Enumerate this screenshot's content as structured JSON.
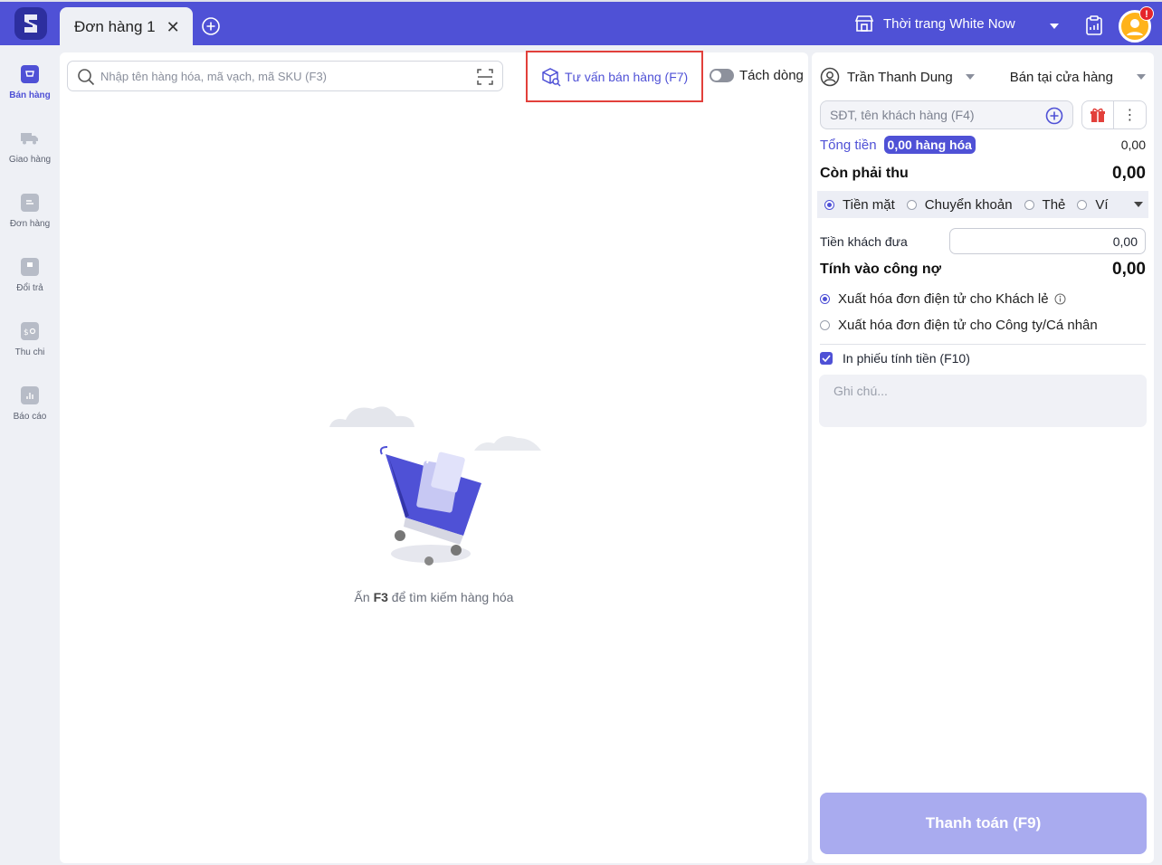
{
  "tabs": [
    {
      "label": "Đơn hàng 1"
    }
  ],
  "header": {
    "store_name": "Thời trang White Now",
    "notification_badge": "!"
  },
  "nav": [
    {
      "label": "Bán hàng",
      "icon": "cart-icon",
      "active": true
    },
    {
      "label": "Giao hàng",
      "icon": "truck-icon"
    },
    {
      "label": "Đơn hàng",
      "icon": "order-doc-icon"
    },
    {
      "label": "Đổi trả",
      "icon": "return-box-icon"
    },
    {
      "label": "Thu chi",
      "icon": "wallet-icon"
    },
    {
      "label": "Báo cáo",
      "icon": "report-chart-icon"
    }
  ],
  "main": {
    "search_placeholder": "Nhập tên hàng hóa, mã vạch, mã SKU (F3)",
    "consult_label": "Tư vấn bán hàng (F7)",
    "split_label": "Tách dòng",
    "empty_prefix": "Ấn",
    "empty_key": "F3",
    "empty_suffix": "để tìm kiếm hàng hóa"
  },
  "order": {
    "staff_name": "Trần Thanh Dung",
    "channel": "Bán tại cửa hàng",
    "customer_placeholder": "SĐT, tên khách hàng (F4)",
    "total_label": "Tổng tiền",
    "items_badge": "0,00 hàng hóa",
    "total_value": "0,00",
    "due_label": "Còn phải thu",
    "due_value": "0,00",
    "payment_methods": [
      "Tiền mặt",
      "Chuyển khoản",
      "Thẻ",
      "Ví"
    ],
    "given_label": "Tiền khách đưa",
    "given_value": "0,00",
    "debt_label": "Tính vào công nợ",
    "debt_value": "0,00",
    "invoice_retail": "Xuất hóa đơn điện tử cho Khách lẻ",
    "invoice_company": "Xuất hóa đơn điện tử cho Công ty/Cá nhân",
    "print_label": "In phiếu tính tiền (F10)",
    "note_placeholder": "Ghi chú...",
    "pay_button": "Thanh toán (F9)"
  },
  "colors": {
    "brand": "#4f51d6",
    "highlight": "#e2403b",
    "pay_disabled": "#a9abef"
  }
}
